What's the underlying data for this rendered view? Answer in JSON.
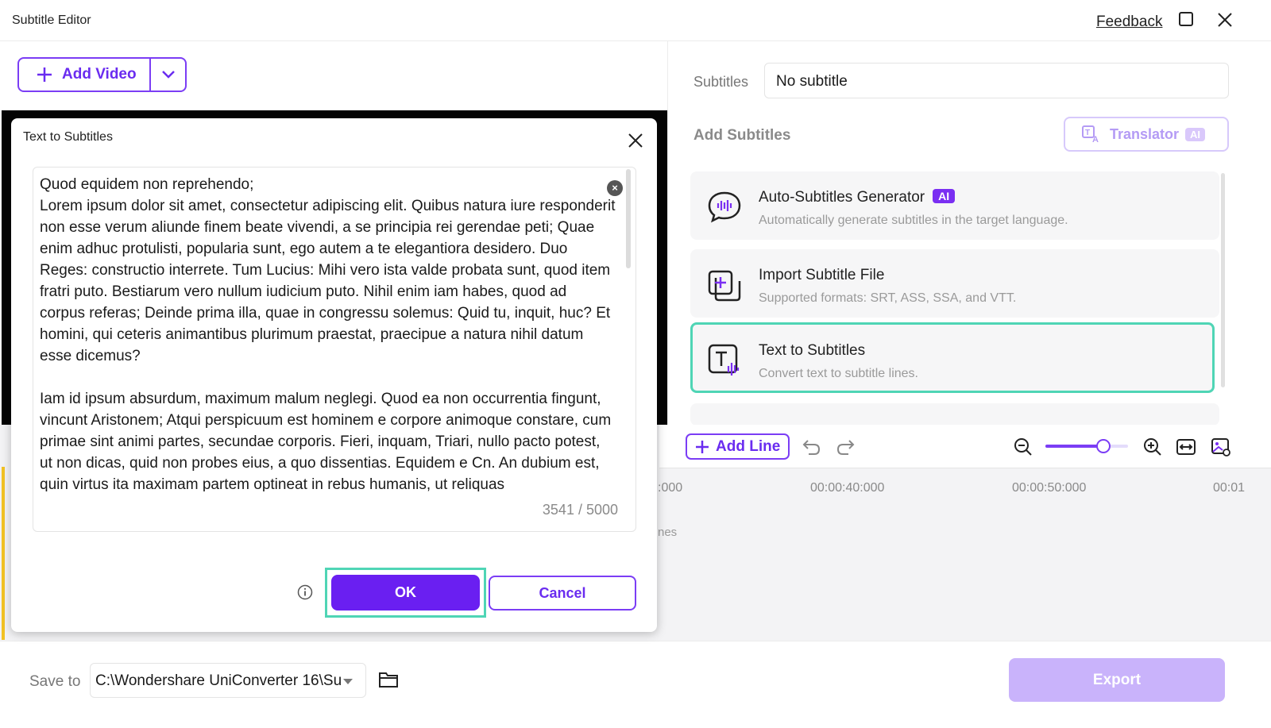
{
  "window": {
    "title": "Subtitle Editor",
    "feedback_label": "Feedback"
  },
  "toolbar": {
    "add_video_label": "Add Video"
  },
  "right_panel": {
    "subtitles_label": "Subtitles",
    "subtitles_value": "No subtitle",
    "add_subtitles_heading": "Add Subtitles",
    "translator_label": "Translator",
    "translator_badge": "AI",
    "options": [
      {
        "name": "Auto-Subtitles Generator",
        "badge": "AI",
        "desc": "Automatically generate subtitles in the target language."
      },
      {
        "name": "Import Subtitle File",
        "desc": "Supported formats: SRT, ASS, SSA, and VTT."
      },
      {
        "name": "Text to Subtitles",
        "desc": "Convert text to subtitle lines."
      }
    ]
  },
  "timeline": {
    "add_line_label": "Add Line",
    "zoom_level": 0.7,
    "timestamps": [
      ":000",
      "00:00:40:000",
      "00:00:50:000",
      "00:01"
    ],
    "lines_partial": "nes"
  },
  "bottom": {
    "save_to_label": "Save to",
    "save_path": "C:\\Wondershare UniConverter 16\\Su",
    "export_label": "Export"
  },
  "dialog": {
    "title": "Text to Subtitles",
    "text": "Quod equidem non reprehendo;\nLorem ipsum dolor sit amet, consectetur adipiscing elit. Quibus natura iure responderit non esse verum aliunde finem beate vivendi, a se principia rei gerendae peti; Quae enim adhuc protulisti, popularia sunt, ego autem a te elegantiora desidero. Duo Reges: constructio interrete. Tum Lucius: Mihi vero ista valde probata sunt, quod item fratri puto. Bestiarum vero nullum iudicium puto. Nihil enim iam habes, quod ad corpus referas; Deinde prima illa, quae in congressu solemus: Quid tu, inquit, huc? Et homini, qui ceteris animantibus plurimum praestat, praecipue a natura nihil datum esse dicemus?\n\nIam id ipsum absurdum, maximum malum neglegi. Quod ea non occurrentia fingunt, vincunt Aristonem; Atqui perspicuum est hominem e corpore animoque constare, cum primae sint animi partes, secundae corporis. Fieri, inquam, Triari, nullo pacto potest, ut non dicas, quid non probes eius, a quo dissentias. Equidem e Cn. An dubium est, quin virtus ita maximam partem optineat in rebus humanis, ut reliquas",
    "counter": "3541 / 5000",
    "ok_label": "OK",
    "cancel_label": "Cancel"
  },
  "colors": {
    "accent": "#6a1ff1",
    "highlight": "#4fd5b5",
    "export_disabled": "#c9b3fb"
  }
}
